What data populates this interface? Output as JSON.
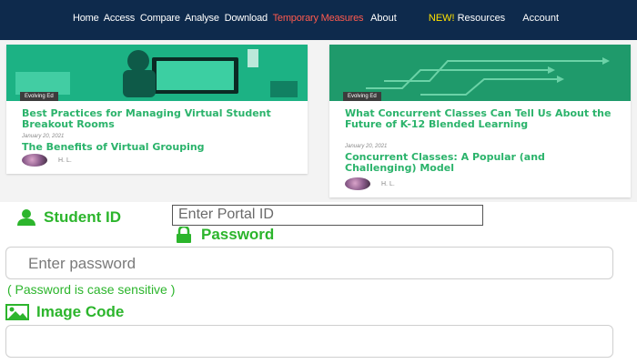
{
  "nav": {
    "left_items": [
      "Home",
      "Access",
      "Compare",
      "Analyse",
      "Download"
    ],
    "special_item": "Temporary Measures",
    "about": "About",
    "new_badge": "NEW!",
    "resources": "Resources",
    "account": "Account"
  },
  "cards": [
    {
      "tag": "Evolving Ed",
      "title": "Best Practices for Managing Virtual Student Breakout Rooms",
      "date": "January 20, 2021",
      "subtitle": "The Benefits of Virtual Grouping",
      "author": "H. L."
    },
    {
      "tag": "Evolving Ed",
      "title": "What Concurrent Classes Can Tell Us About the Future of K-12 Blended Learning",
      "date": "January 20, 2021",
      "subtitle": "Concurrent Classes: A Popular (and Challenging) Model",
      "author": "H. L."
    }
  ],
  "form": {
    "student_id_label": "Student ID",
    "portal_placeholder": "Enter Portal ID",
    "password_label": "Password",
    "password_placeholder": "Enter password",
    "case_note": "( Password is case sensitive )",
    "image_code_label": "Image Code",
    "image_code_value": ""
  },
  "colors": {
    "nav_bg": "#0e2a4c",
    "accent_green": "#2cb52c",
    "card_title_green": "#2bb36b",
    "special_red": "#ff5a4e",
    "new_yellow": "#ffe100"
  }
}
